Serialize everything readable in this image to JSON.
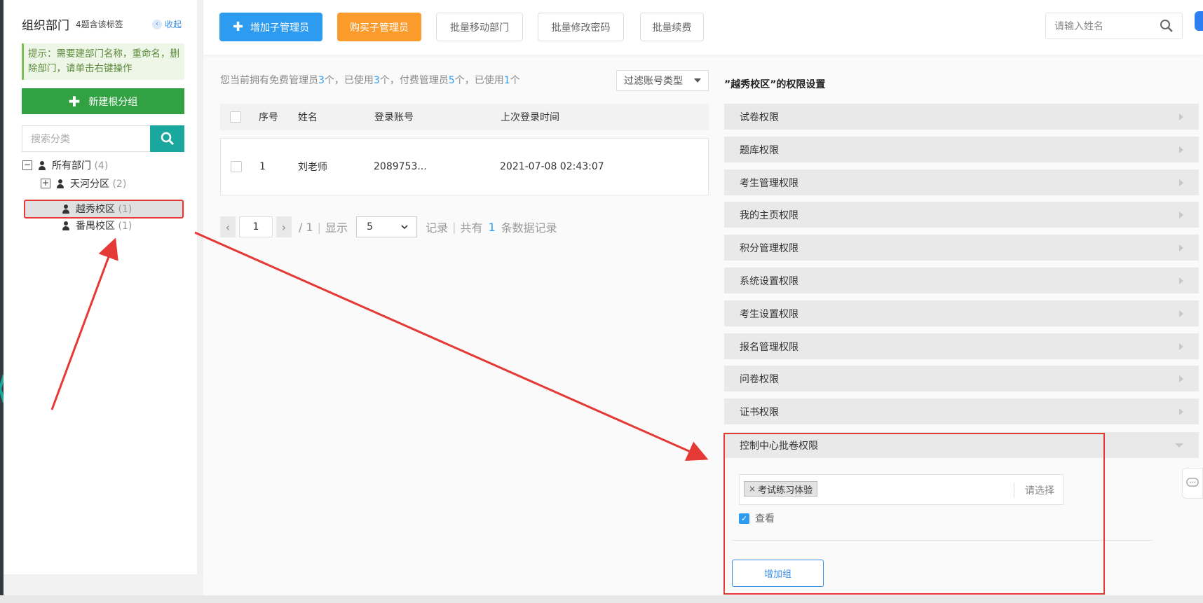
{
  "sidebar": {
    "title": "组织部门",
    "subtitle": "4题含该标签",
    "collapse_label": "收起",
    "tip": "提示：需要建部门名称，重命名，删除部门，请单击右键操作",
    "new_root_label": "新建根分组",
    "search_placeholder": "搜索分类",
    "tree": [
      {
        "toggle": "−",
        "label": "所有部门",
        "count": "(4)"
      },
      {
        "toggle": "+",
        "label": "天河分区",
        "count": "(2)"
      },
      {
        "toggle": "",
        "label": "越秀校区",
        "count": "(1)"
      },
      {
        "toggle": "",
        "label": "番禺校区",
        "count": "(1)"
      }
    ]
  },
  "toolbar": {
    "add_sub_admin": "增加子管理员",
    "buy_sub_admin": "购买子管理员",
    "batch_move": "批量移动部门",
    "batch_password": "批量修改密码",
    "batch_renew": "批量续费",
    "name_search_placeholder": "请输入姓名"
  },
  "summary": {
    "p1": "您当前拥有免费管理员",
    "free_total": "3",
    "p2": "个，已使用",
    "free_used": "3",
    "p3": "个，付费管理员",
    "paid_total": "5",
    "p4": "个，已使用",
    "paid_used": "1",
    "p5": "个",
    "filter_label": "过滤账号类型"
  },
  "table": {
    "headers": {
      "seq": "序号",
      "name": "姓名",
      "account": "登录账号",
      "last_login": "上次登录时间"
    },
    "rows": [
      {
        "seq": "1",
        "name": "刘老师",
        "account": "2089753...",
        "last_login": "2021-07-08 02:43:07"
      }
    ]
  },
  "pager": {
    "page": "1",
    "total_pages": "/ 1",
    "show_label": "显示",
    "page_size": "5",
    "records_label": "记录",
    "total_prefix": "共有",
    "total_count": "1",
    "total_suffix": "条数据记录"
  },
  "permissions": {
    "title": "”越秀校区”的权限设置",
    "groups": [
      "试卷权限",
      "题库权限",
      "考生管理权限",
      "我的主页权限",
      "积分管理权限",
      "系统设置权限",
      "考生设置权限",
      "报名管理权限",
      "问卷权限",
      "证书权限"
    ],
    "expanded": {
      "label": "控制中心批卷权限",
      "tag": "考试练习体验",
      "tag_remove": "×",
      "select_placeholder": "请选择",
      "view_label": "查看",
      "view_checked": true,
      "add_group_label": "增加组"
    }
  },
  "colors": {
    "primary": "#2d9cf0",
    "orange": "#fa9b2c",
    "green": "#32a144",
    "teal": "#1aa89e",
    "annotation_red": "#e53935"
  }
}
